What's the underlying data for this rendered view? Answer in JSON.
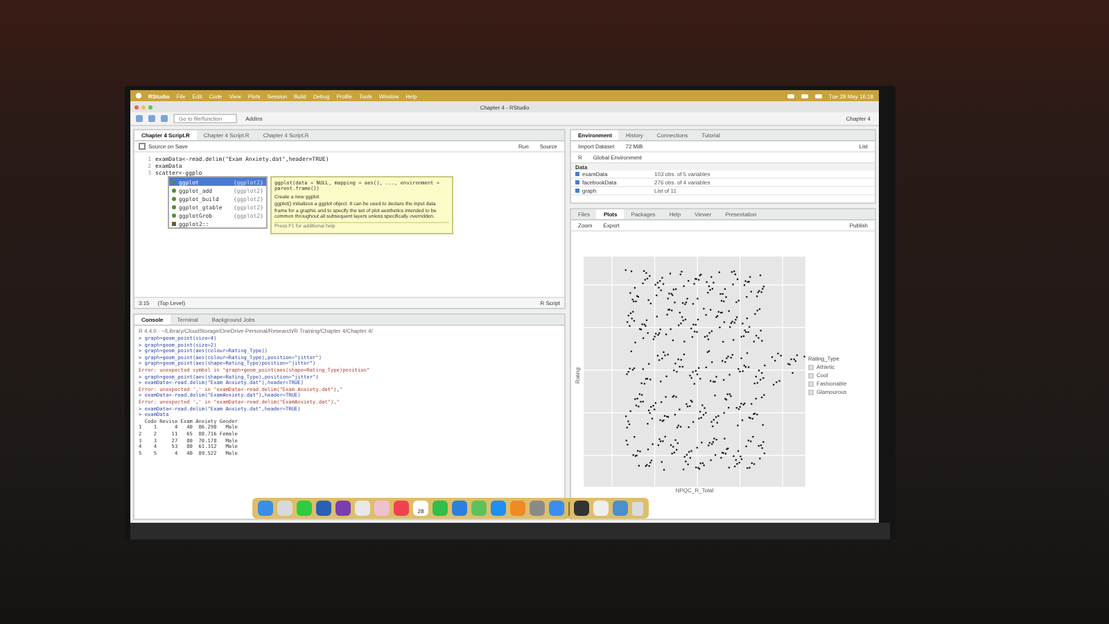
{
  "menu_bar": {
    "app": "RStudio",
    "items": [
      "File",
      "Edit",
      "Code",
      "View",
      "Plots",
      "Session",
      "Build",
      "Debug",
      "Profile",
      "Tools",
      "Window",
      "Help"
    ],
    "clock": "Tue 28 May 16:18"
  },
  "window": {
    "title": "Chapter 4 - RStudio",
    "project": "Chapter 4"
  },
  "toolbar": {
    "goto_placeholder": "Go to file/function",
    "addins": "Addins"
  },
  "editor": {
    "tabs": [
      {
        "label": "Chapter 4 Script.R",
        "selected": true
      },
      {
        "label": "Chapter 4 Script.R",
        "selected": false
      },
      {
        "label": "Chapter 4 Script.R",
        "selected": false
      }
    ],
    "source_on_save": "Source on Save",
    "source_on_save_checked": false,
    "run": "Run",
    "source": "Source",
    "lines": [
      {
        "number": "1",
        "code": "examData<-read.delim(\"Exam Anxiety.dat\",header=TRUE)"
      },
      {
        "number": "2",
        "code": "examData"
      },
      {
        "number": "3",
        "code": "scatter<-ggplo"
      }
    ],
    "autocomplete": {
      "items": [
        {
          "name": "ggplot",
          "package": "{ggplot2}",
          "kind": "function",
          "selected": true
        },
        {
          "name": "ggplot_add",
          "package": "{ggplot2}",
          "kind": "function",
          "selected": false
        },
        {
          "name": "ggplot_build",
          "package": "{ggplot2}",
          "kind": "function",
          "selected": false
        },
        {
          "name": "ggplot_gtable",
          "package": "{ggplot2}",
          "kind": "function",
          "selected": false
        },
        {
          "name": "ggplotGrob",
          "package": "{ggplot2}",
          "kind": "function",
          "selected": false
        },
        {
          "name": "ggplot2::",
          "kind": "package",
          "selected": false
        }
      ],
      "tooltip": {
        "signature": "ggplot(data = NULL, mapping = aes(), ..., environment = parent.frame())",
        "title": "Create a new ggplot",
        "description": "ggplot() initializes a ggplot object. It can be used to declare the input data frame for a graphic and to specify the set of plot aesthetics intended to be common throughout all subsequent layers unless specifically overridden.",
        "help": "Press F1 for additional help"
      }
    },
    "status": {
      "position": "3:15",
      "scope": "(Top Level)",
      "type": "R Script"
    }
  },
  "console": {
    "tabs": [
      {
        "label": "Console",
        "selected": true
      },
      {
        "label": "Terminal",
        "selected": false
      },
      {
        "label": "Background Jobs",
        "selected": false
      }
    ],
    "path": "R 4.4.0 · ~/Library/CloudStorage/OneDrive-Personal/Research/R Training/Chapter 4/Chapter 4/",
    "lines": [
      {
        "kind": "command",
        "text": "> graph+geom_point(size=4)"
      },
      {
        "kind": "command",
        "text": "> graph+geom_point(size=2)"
      },
      {
        "kind": "command",
        "text": "> graph+geom_point(aes(colour=Rating_Type))"
      },
      {
        "kind": "command",
        "text": "> graph+geom_point(aes(colour=Rating_Type),position=\"jitter\")"
      },
      {
        "kind": "command",
        "text": "> graph+geom_point(aes(shape=Rating_Type)position=\"jitter\")"
      },
      {
        "kind": "error",
        "text": "Error: unexpected symbol in \"graph+geom_point(aes(shape=Rating_Type)position\""
      },
      {
        "kind": "command",
        "text": "> graph+geom_point(aes(shape=Rating_Type),position=\"jitter\")"
      },
      {
        "kind": "command",
        "text": "> examData<-read.delim(\"Exam Anxiety.dat\"),header=TRUE)"
      },
      {
        "kind": "error",
        "text": "Error: unexpected ',' in \"examData<-read.delim(\"Exam Anxiety.dat\"),\""
      },
      {
        "kind": "command",
        "text": "> examData<-read.delim(\"ExamAnxiety.dat\"),header=TRUE)"
      },
      {
        "kind": "error",
        "text": "Error: unexpected ',' in \"examData<-read.delim(\"ExamAnxiety.dat\"),\""
      },
      {
        "kind": "command",
        "text": "> examData<-read.delim(\"Exam Anxiety.dat\",header=TRUE)"
      },
      {
        "kind": "command",
        "text": "> examData"
      },
      {
        "kind": "output",
        "text": "  Code Revise Exam Anxiety Gender"
      },
      {
        "kind": "output",
        "text": "1    1      4   40  86.298   Male"
      },
      {
        "kind": "output",
        "text": "2    2     11   65  88.716 Female"
      },
      {
        "kind": "output",
        "text": "3    3     27   80  70.178   Male"
      },
      {
        "kind": "output",
        "text": "4    4     53   80  61.312   Male"
      },
      {
        "kind": "output",
        "text": "5    5      4   40  89.522   Male"
      }
    ]
  },
  "environment": {
    "tabs": [
      {
        "label": "Environment",
        "selected": true
      },
      {
        "label": "History",
        "selected": false
      },
      {
        "label": "Connections",
        "selected": false
      },
      {
        "label": "Tutorial",
        "selected": false
      }
    ],
    "import": "Import Dataset",
    "memory": "72 MiB",
    "list": "List",
    "language": "R",
    "scope": "Global Environment",
    "section": "Data",
    "rows": [
      {
        "name": "examData",
        "value": "103 obs. of 5 variables"
      },
      {
        "name": "facebookData",
        "value": "276 obs. of 4 variables"
      },
      {
        "name": "graph",
        "value": "List of 11"
      }
    ]
  },
  "plots": {
    "tabs": [
      {
        "label": "Files",
        "selected": false
      },
      {
        "label": "Plots",
        "selected": true
      },
      {
        "label": "Packages",
        "selected": false
      },
      {
        "label": "Help",
        "selected": false
      },
      {
        "label": "Viewer",
        "selected": false
      },
      {
        "label": "Presentation",
        "selected": false
      }
    ],
    "zoom": "Zoom",
    "export": "Export",
    "publish": "Publish",
    "xlabel": "NPQC_R_Total",
    "ylabel": "Rating",
    "legend": {
      "title": "Rating_Type",
      "items": [
        "Athletic",
        "Cool",
        "Fashionable",
        "Glamourous"
      ]
    }
  },
  "dock": {
    "apps": [
      {
        "color": "#3a8ee6"
      },
      {
        "color": "#d9d9d9"
      },
      {
        "color": "#2ecc40"
      },
      {
        "color": "#2b5fb5"
      },
      {
        "color": "#7b3fb0"
      },
      {
        "color": "#e8e8e8"
      },
      {
        "color": "#f0c0d0"
      },
      {
        "color": "#f2424f"
      },
      {
        "color": "#ffffff",
        "label": "28"
      },
      {
        "color": "#2fbf4a"
      },
      {
        "color": "#2a7fe0"
      },
      {
        "color": "#5cc35c"
      },
      {
        "color": "#1e8ef0"
      },
      {
        "color": "#f08a24"
      },
      {
        "color": "#8a8a8a"
      },
      {
        "color": "#3b8ef0"
      }
    ],
    "utilities": [
      {
        "color": "#333333"
      },
      {
        "color": "#eeeeee"
      },
      {
        "color": "#4a8fd0"
      }
    ]
  }
}
